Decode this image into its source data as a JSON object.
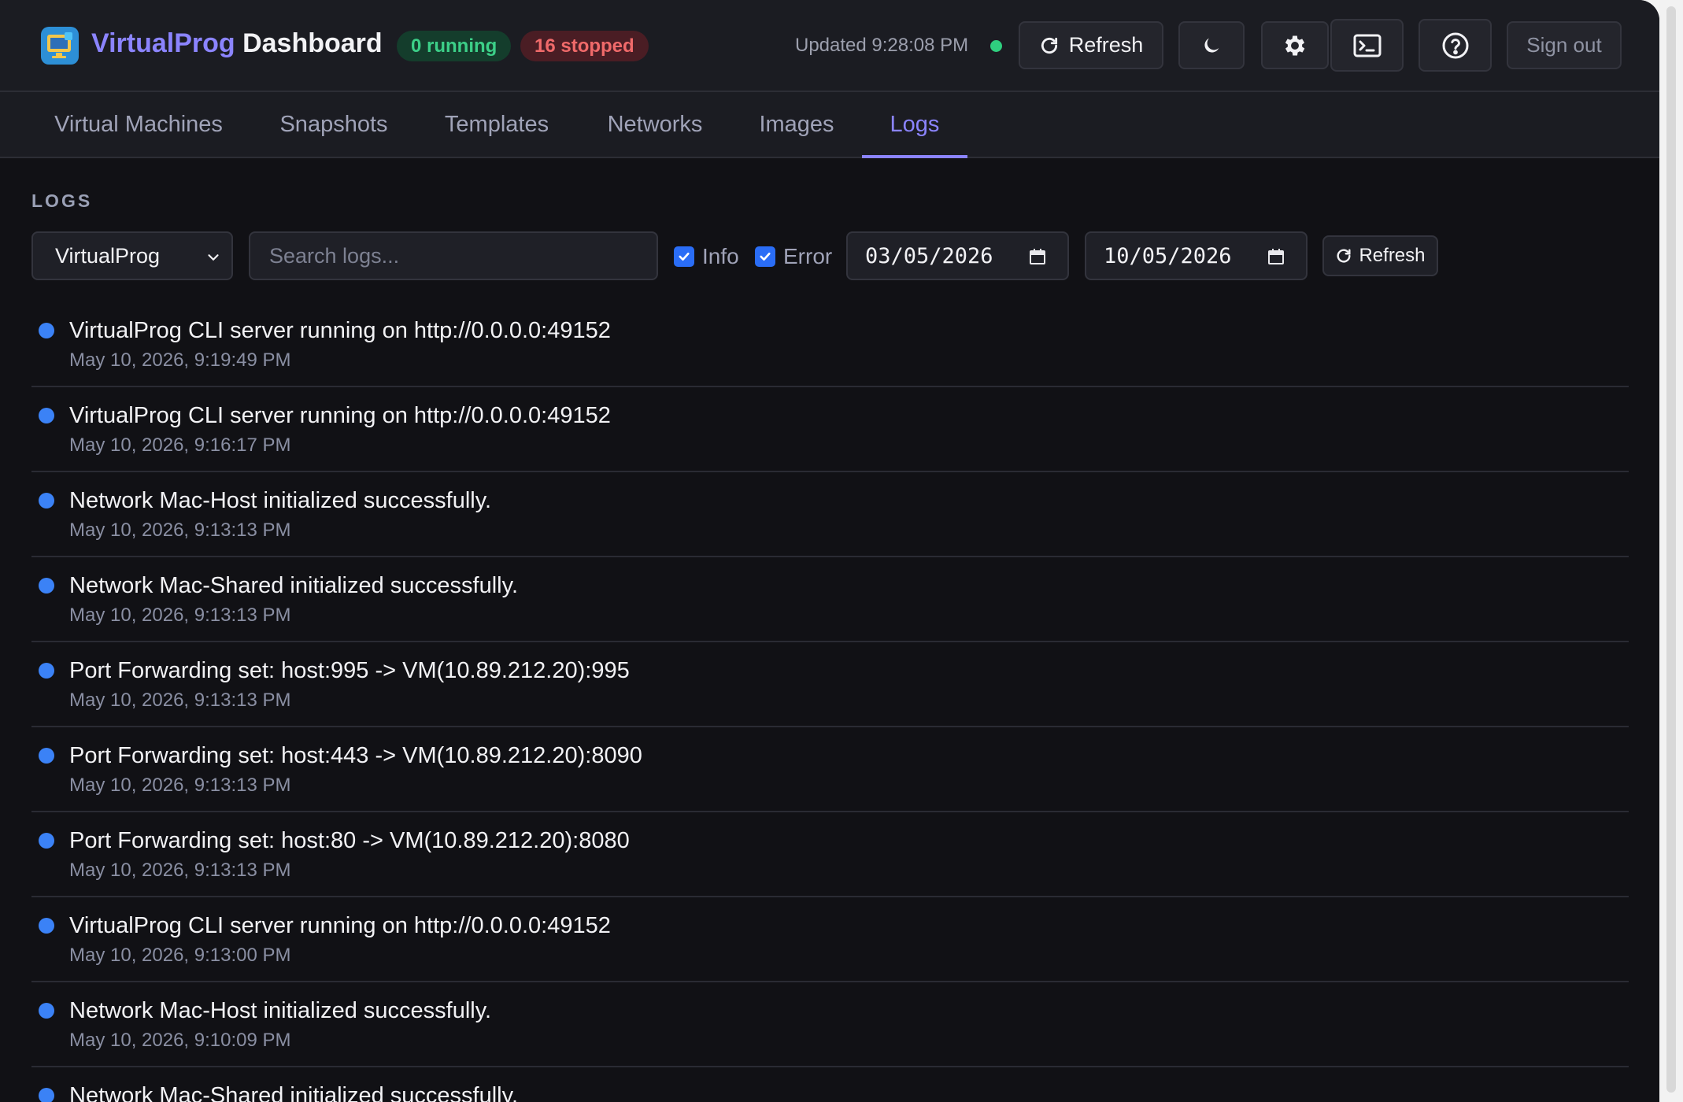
{
  "header": {
    "brand_accent": "VirtualProg",
    "brand_rest": " Dashboard",
    "running_badge": "0 running",
    "stopped_badge": "16 stopped",
    "updated_text": "Updated 9:28:08 PM",
    "refresh_label": "Refresh",
    "signout_label": "Sign out",
    "icons": [
      "app-logo-icon",
      "refresh-icon",
      "moon-icon",
      "gear-icon",
      "terminal-icon",
      "help-icon"
    ]
  },
  "tabs": [
    {
      "label": "Virtual Machines",
      "active": false
    },
    {
      "label": "Snapshots",
      "active": false
    },
    {
      "label": "Templates",
      "active": false
    },
    {
      "label": "Networks",
      "active": false
    },
    {
      "label": "Images",
      "active": false
    },
    {
      "label": "Logs",
      "active": true
    }
  ],
  "logs": {
    "section_title": "LOGS",
    "source_selected": "VirtualProg",
    "search_placeholder": "Search logs...",
    "search_value": "",
    "filter_info_label": "Info",
    "filter_info_checked": true,
    "filter_error_label": "Error",
    "filter_error_checked": true,
    "date_from": "03/05/2026",
    "date_to": "10/05/2026",
    "refresh_label": "Refresh",
    "entries": [
      {
        "message": "VirtualProg CLI server running on http://0.0.0.0:49152",
        "time": "May 10, 2026, 9:19:49 PM",
        "level": "info"
      },
      {
        "message": "VirtualProg CLI server running on http://0.0.0.0:49152",
        "time": "May 10, 2026, 9:16:17 PM",
        "level": "info"
      },
      {
        "message": "Network Mac-Host initialized successfully.",
        "time": "May 10, 2026, 9:13:13 PM",
        "level": "info"
      },
      {
        "message": "Network Mac-Shared initialized successfully.",
        "time": "May 10, 2026, 9:13:13 PM",
        "level": "info"
      },
      {
        "message": "Port Forwarding set: host:995 -> VM(10.89.212.20):995",
        "time": "May 10, 2026, 9:13:13 PM",
        "level": "info"
      },
      {
        "message": "Port Forwarding set: host:443 -> VM(10.89.212.20):8090",
        "time": "May 10, 2026, 9:13:13 PM",
        "level": "info"
      },
      {
        "message": "Port Forwarding set: host:80 -> VM(10.89.212.20):8080",
        "time": "May 10, 2026, 9:13:13 PM",
        "level": "info"
      },
      {
        "message": "VirtualProg CLI server running on http://0.0.0.0:49152",
        "time": "May 10, 2026, 9:13:00 PM",
        "level": "info"
      },
      {
        "message": "Network Mac-Host initialized successfully.",
        "time": "May 10, 2026, 9:10:09 PM",
        "level": "info"
      },
      {
        "message": "Network Mac-Shared initialized successfully.",
        "time": "",
        "level": "info"
      }
    ]
  },
  "colors": {
    "accent": "#8b84ff",
    "info_dot": "#3b82f6",
    "running": "#3ccf88",
    "stopped": "#f06a6a"
  }
}
